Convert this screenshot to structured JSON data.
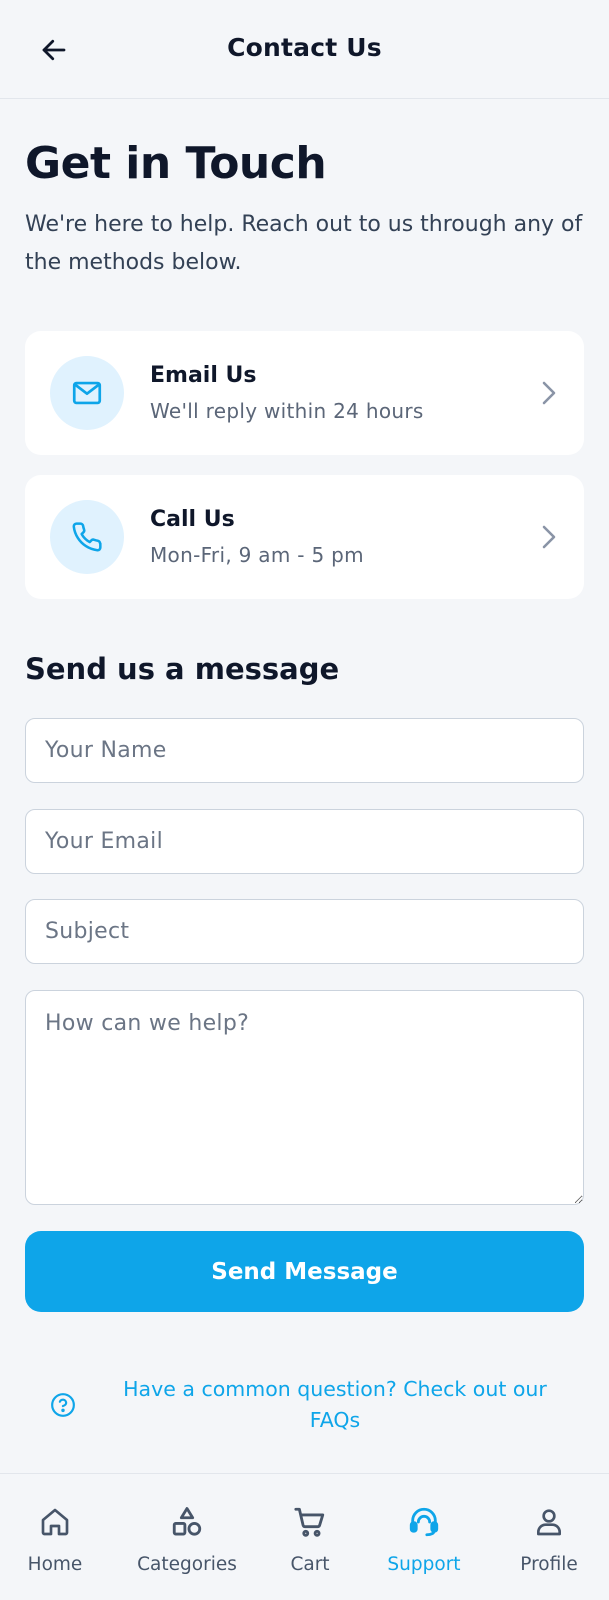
{
  "header": {
    "title": "Contact Us",
    "back_icon": "arrow-left-icon"
  },
  "hero": {
    "title": "Get in Touch",
    "subtitle": "We're here to help. Reach out to us through any of the methods below."
  },
  "contact_methods": [
    {
      "title": "Email Us",
      "subtitle": "We'll reply within 24 hours",
      "icon": "mail-icon"
    },
    {
      "title": "Call Us",
      "subtitle": "Mon-Fri, 9 am - 5 pm",
      "icon": "phone-icon"
    }
  ],
  "form": {
    "title": "Send us a message",
    "name_placeholder": "Your Name",
    "name_value": "",
    "email_placeholder": "Your Email",
    "email_value": "",
    "subject_placeholder": "Subject",
    "subject_value": "",
    "message_placeholder": "How can we help?",
    "message_value": "",
    "submit_label": "Send Message"
  },
  "faq": {
    "text": "Have a common question? Check out our FAQs",
    "icon": "help-circle-icon"
  },
  "bottom_nav": {
    "items": [
      {
        "label": "Home",
        "icon": "home-icon",
        "active": false
      },
      {
        "label": "Categories",
        "icon": "shapes-icon",
        "active": false
      },
      {
        "label": "Cart",
        "icon": "cart-icon",
        "active": false
      },
      {
        "label": "Support",
        "icon": "headset-icon",
        "active": true
      },
      {
        "label": "Profile",
        "icon": "user-icon",
        "active": false
      }
    ]
  },
  "colors": {
    "accent": "#0ea5e9",
    "background": "#f4f6f9",
    "text_primary": "#0f172a",
    "text_secondary": "#5b6678",
    "icon_bubble": "#e0f2fe"
  }
}
